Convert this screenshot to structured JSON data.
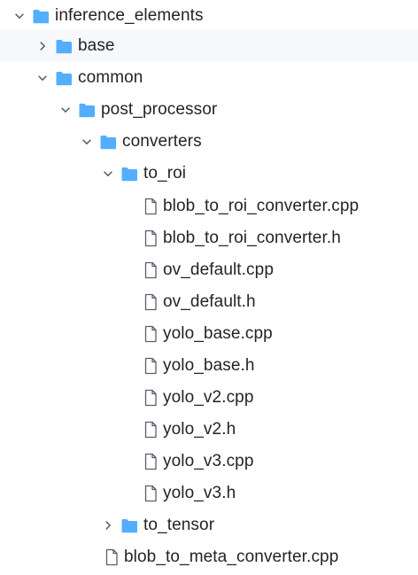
{
  "tree": {
    "rows": [
      {
        "label": "inference_elements",
        "type": "folder",
        "expanded": true,
        "depth": 0
      },
      {
        "label": "base",
        "type": "folder",
        "expanded": false,
        "depth": 1
      },
      {
        "label": "common",
        "type": "folder",
        "expanded": true,
        "depth": 1
      },
      {
        "label": "post_processor",
        "type": "folder",
        "expanded": true,
        "depth": 2
      },
      {
        "label": "converters",
        "type": "folder",
        "expanded": true,
        "depth": 3
      },
      {
        "label": "to_roi",
        "type": "folder",
        "expanded": true,
        "depth": 4
      },
      {
        "label": "blob_to_roi_converter.cpp",
        "type": "file",
        "depth": 5
      },
      {
        "label": "blob_to_roi_converter.h",
        "type": "file",
        "depth": 5
      },
      {
        "label": "ov_default.cpp",
        "type": "file",
        "depth": 5
      },
      {
        "label": "ov_default.h",
        "type": "file",
        "depth": 5
      },
      {
        "label": "yolo_base.cpp",
        "type": "file",
        "depth": 5
      },
      {
        "label": "yolo_base.h",
        "type": "file",
        "depth": 5
      },
      {
        "label": "yolo_v2.cpp",
        "type": "file",
        "depth": 5
      },
      {
        "label": "yolo_v2.h",
        "type": "file",
        "depth": 5
      },
      {
        "label": "yolo_v3.cpp",
        "type": "file",
        "depth": 5
      },
      {
        "label": "yolo_v3.h",
        "type": "file",
        "depth": 5
      },
      {
        "label": "to_tensor",
        "type": "folder",
        "expanded": false,
        "depth": 4
      },
      {
        "label": "blob_to_meta_converter.cpp",
        "type": "file",
        "depth": 3
      }
    ]
  },
  "colors": {
    "folder": "#54aeff",
    "icon_stroke": "#57606a",
    "hover_bg": "#f6f8fa",
    "text": "#1f2328"
  },
  "icons": {
    "folder": "folder-icon",
    "file": "file-icon",
    "expanded": "chevron-down-icon",
    "collapsed": "chevron-right-icon"
  }
}
